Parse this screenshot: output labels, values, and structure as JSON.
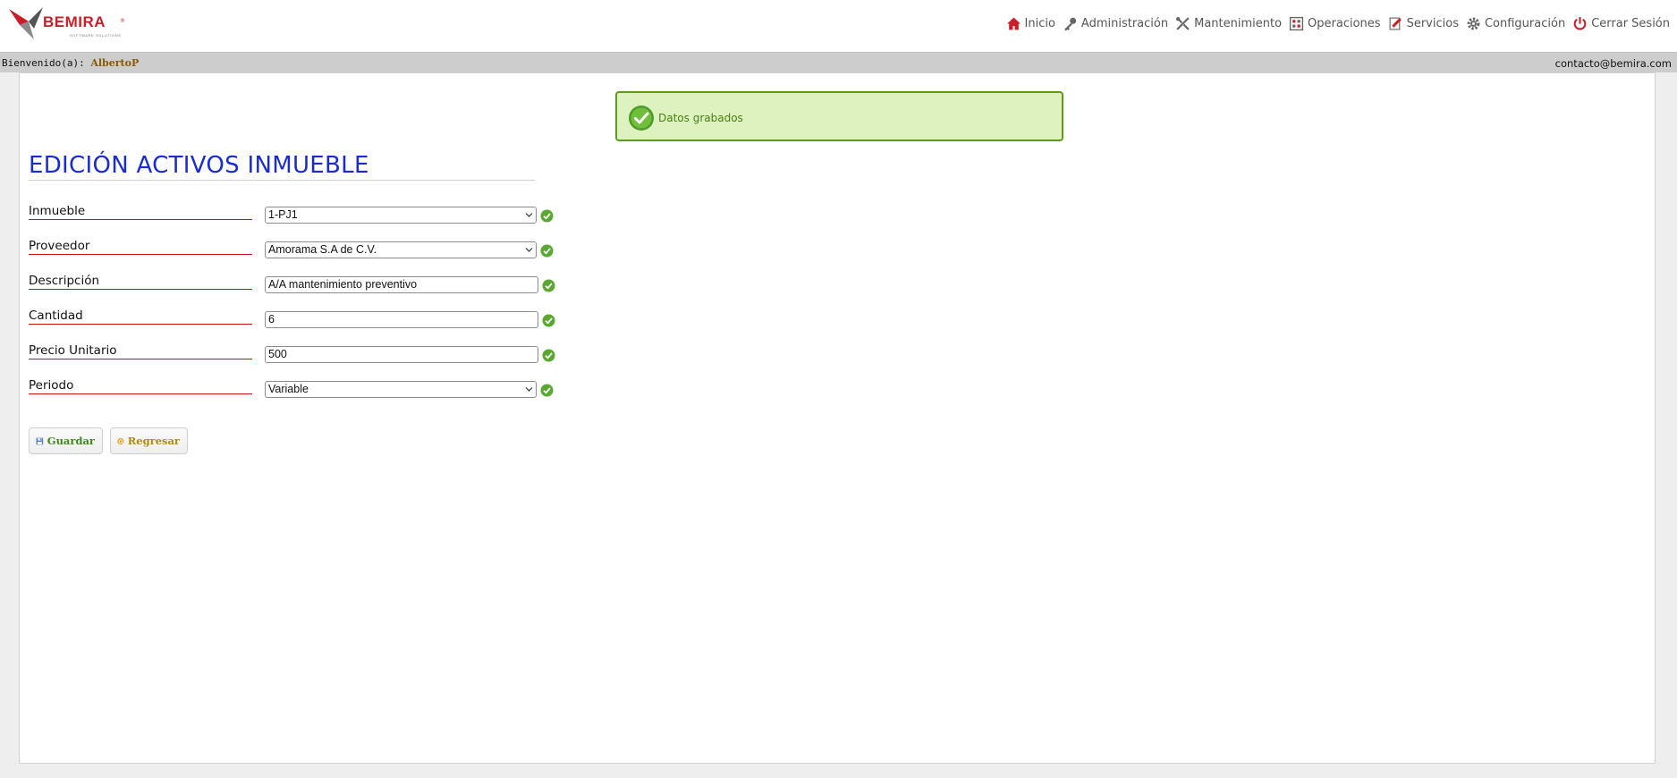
{
  "brand": {
    "name": "BEMIRA",
    "tagline": "SOFTWARE SOLUTIONS",
    "reg": "®"
  },
  "nav": {
    "items": [
      {
        "label": "Inicio",
        "icon": "home-icon"
      },
      {
        "label": "Administración",
        "icon": "key-icon"
      },
      {
        "label": "Mantenimiento",
        "icon": "tools-icon"
      },
      {
        "label": "Operaciones",
        "icon": "grid-icon"
      },
      {
        "label": "Servicios",
        "icon": "edit-icon"
      },
      {
        "label": "Configuración",
        "icon": "gear-icon"
      },
      {
        "label": "Cerrar Sesión",
        "icon": "power-icon"
      }
    ]
  },
  "welcome": {
    "prefix": "Bienvenido(a):",
    "user": "AlbertoP",
    "contact": "contacto@bemira.com"
  },
  "alert": {
    "message": "Datos grabados"
  },
  "page": {
    "title": "EDICIÓN ACTIVOS INMUEBLE"
  },
  "form": {
    "inmueble": {
      "label": "Inmueble",
      "value": "1-PJ1"
    },
    "proveedor": {
      "label": "Proveedor",
      "value": "Amorama S.A de C.V."
    },
    "descripcion": {
      "label": "Descripción",
      "value": "A/A mantenimiento preventivo"
    },
    "cantidad": {
      "label": "Cantidad",
      "value": "6"
    },
    "precio": {
      "label": "Precio Unitario",
      "value": "500"
    },
    "periodo": {
      "label": "Periodo",
      "value": "Variable"
    }
  },
  "buttons": {
    "save": "Guardar",
    "back": "Regresar"
  },
  "colors": {
    "title": "#1a2bd0",
    "accent": "#c8202a",
    "success": "#5e9b1d"
  }
}
